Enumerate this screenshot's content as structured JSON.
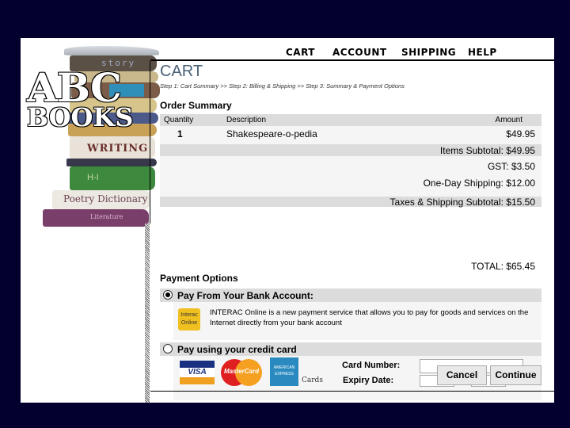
{
  "logo": {
    "line1": "ABC",
    "line2": "BOOKS"
  },
  "graphic": {
    "spine_top": "story",
    "spine_writing": "WRITING",
    "spine_green": "H-I",
    "spine_poetry": "Poetry Dictionary",
    "spine_literature": "Literature"
  },
  "nav": [
    "CART",
    "ACCOUNT",
    "SHIPPING",
    "HELP"
  ],
  "page": {
    "title": "CART",
    "steps": "Step 1: Cart Summary >> Step 2: Billing & Shipping >> Step 3: Summary & Payment Options"
  },
  "order": {
    "heading": "Order Summary",
    "columns": {
      "quantity": "Quantity",
      "description": "Description",
      "amount": "Amount"
    },
    "items": [
      {
        "quantity": "1",
        "description": "Shakespeare-o-pedia",
        "amount": "$49.95"
      }
    ],
    "items_subtotal": "Items Subtotal: $49.95",
    "gst": "GST: $3.50",
    "shipping": "One-Day Shipping: $12.00",
    "taxes_shipping_subtotal": "Taxes & Shipping Subtotal: $15.50",
    "total": "TOTAL: $65.45"
  },
  "payment": {
    "heading": "Payment Options",
    "bank": {
      "label": "Pay From Your Bank Account:",
      "selected": true,
      "logo_line1": "Interac",
      "logo_line2": "Online",
      "description": "INTERAC Online is a new payment service that allows you to pay for goods and services on the Internet directly from your bank account"
    },
    "credit": {
      "label": "Pay using your credit card",
      "selected": false,
      "visa": "VISA",
      "mastercard": "MasterCard",
      "amex": "AMERICAN EXPRESS",
      "cards_text": "Cards",
      "card_number_label": "Card Number:",
      "card_number_value": "",
      "expiry_label": "Expiry Date:",
      "expiry_month": "",
      "expiry_year": ""
    }
  },
  "buttons": {
    "cancel": "Cancel",
    "continue": "Continue"
  }
}
